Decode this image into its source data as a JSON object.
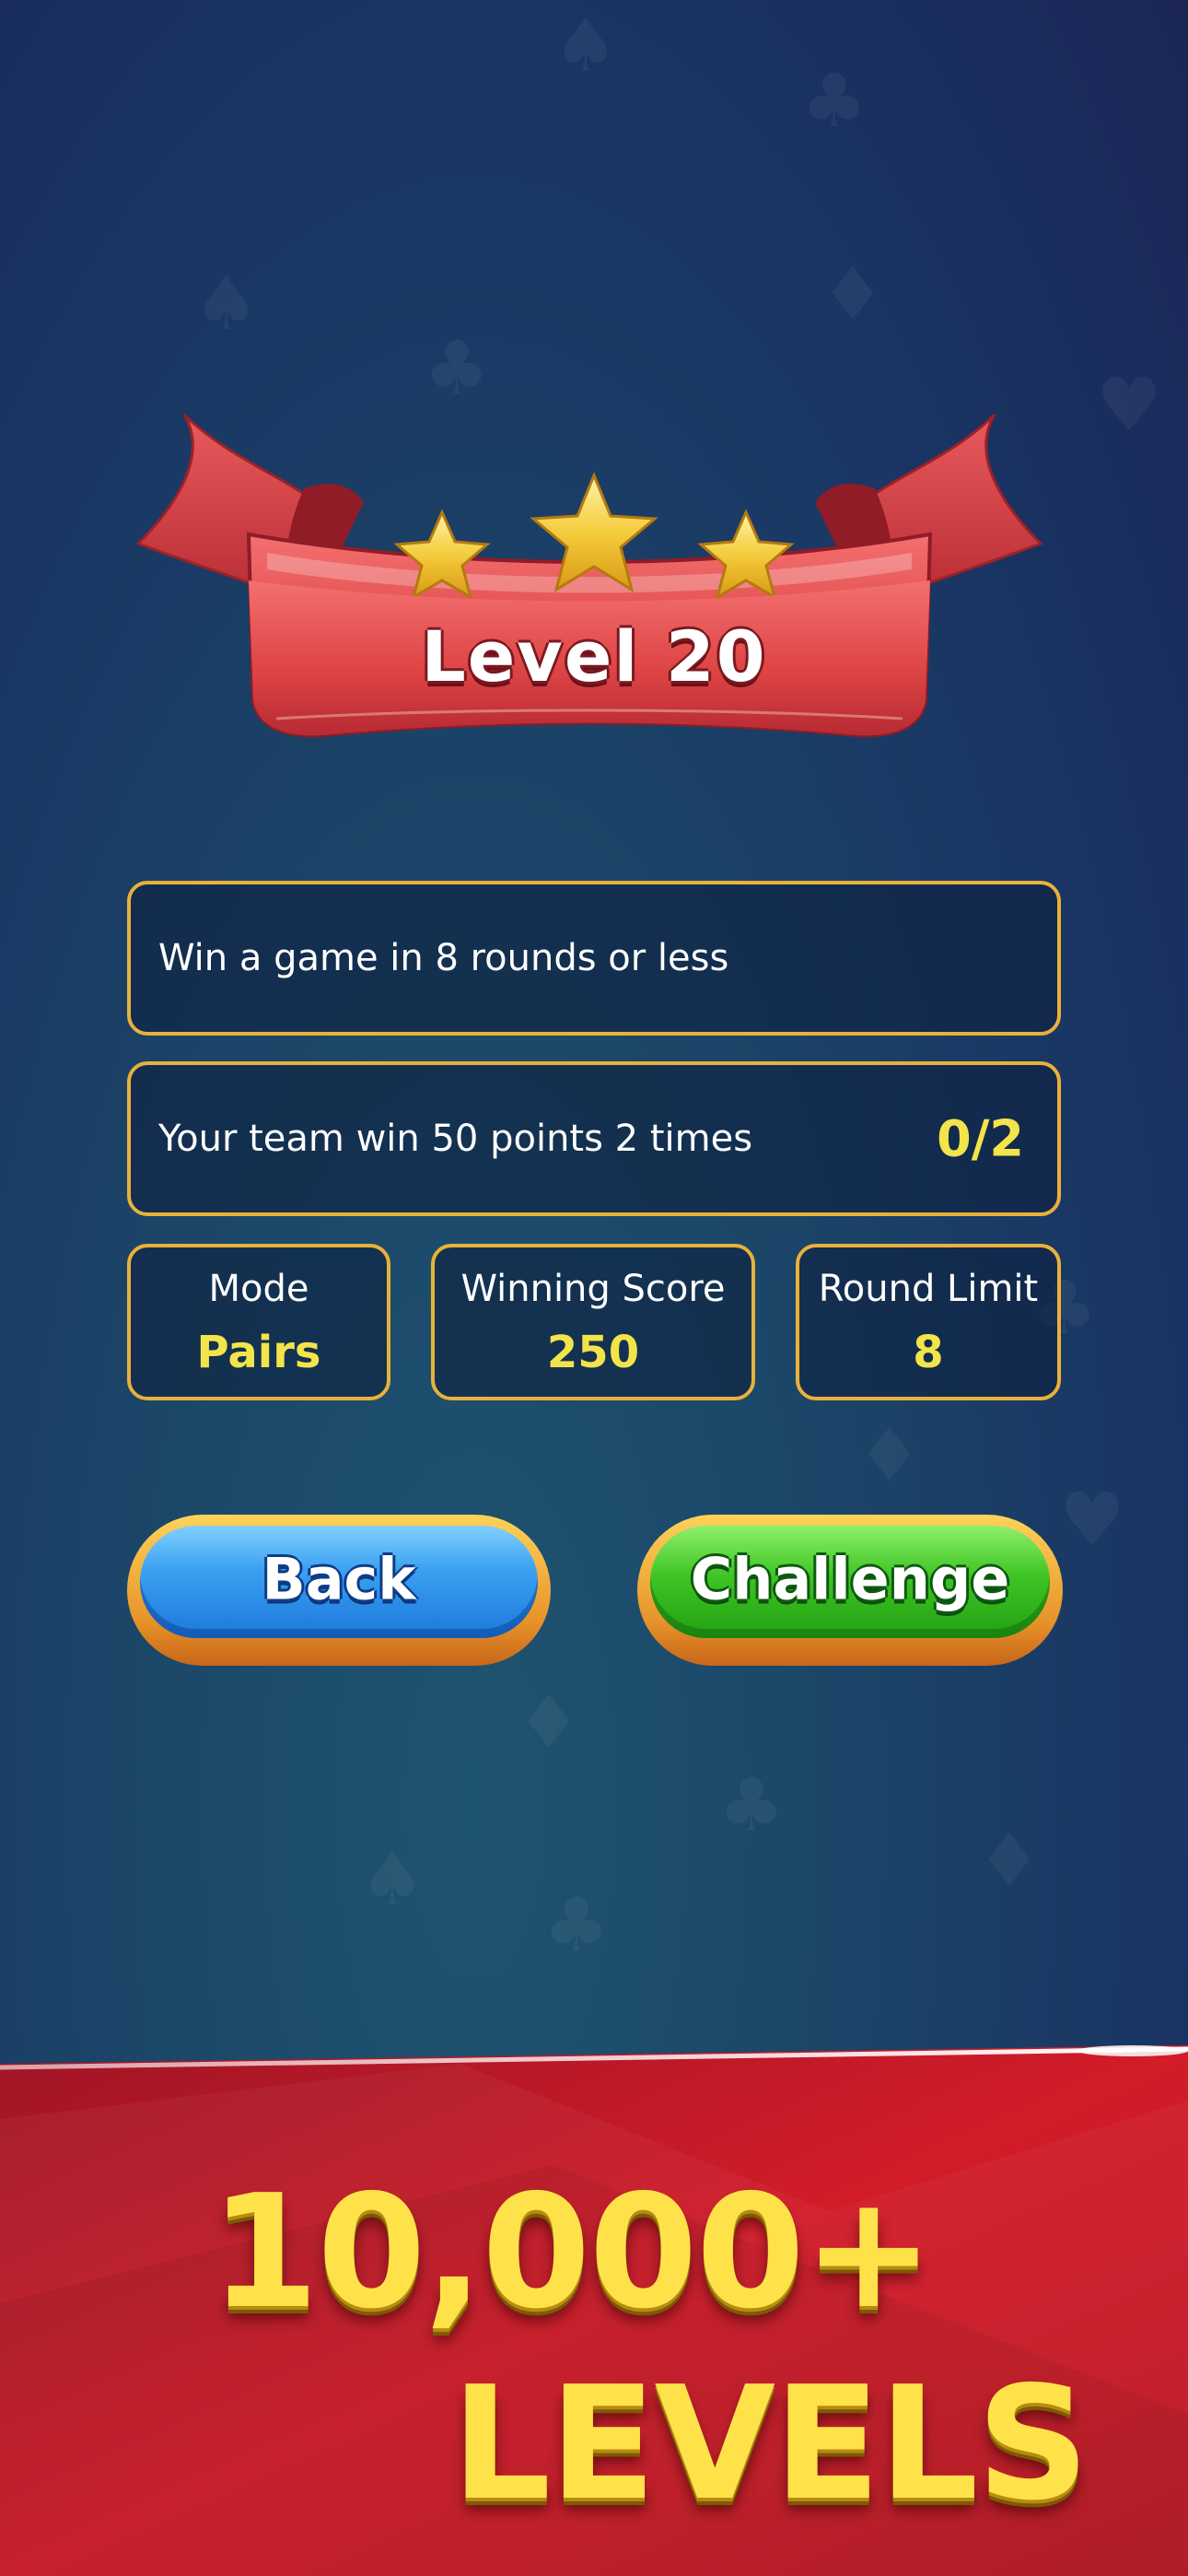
{
  "level": {
    "title": "Level 20",
    "stars": 3
  },
  "objectives": [
    {
      "text": "Win a game in 8 rounds or less",
      "progress": ""
    },
    {
      "text": "Your team win 50 points 2 times",
      "progress": "0/2"
    }
  ],
  "stats": [
    {
      "label": "Mode",
      "value": "Pairs"
    },
    {
      "label": "Winning Score",
      "value": "250"
    },
    {
      "label": "Round Limit",
      "value": "8"
    }
  ],
  "buttons": {
    "back_label": "Back",
    "challenge_label": "Challenge"
  },
  "promo": {
    "line1": "10,000+",
    "line2": "LEVELS"
  },
  "colors": {
    "accent_gold": "#e9b13a",
    "value_yellow": "#f2e44a",
    "ribbon_red": "#e04a4a",
    "banner_red": "#c8182a",
    "back_blue": "#2a8ae8",
    "challenge_green": "#35b81e"
  },
  "icons": [
    "star-icon",
    "spade-icon",
    "club-icon",
    "diamond-icon",
    "heart-icon"
  ]
}
